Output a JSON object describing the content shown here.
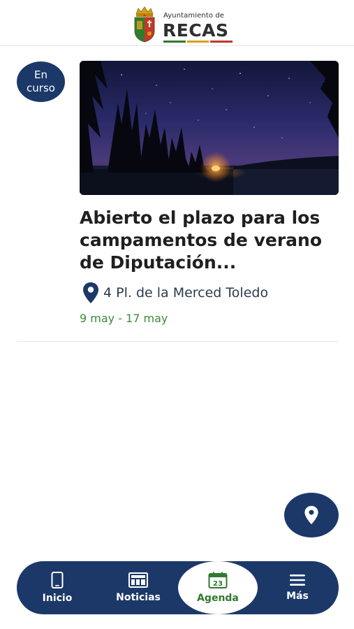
{
  "header": {
    "brand_small": "Ayuntamiento de",
    "brand_name": "RECAS",
    "logo_icon": "coat-of-arms",
    "stripe_colors": [
      "#2f7a2e",
      "#d4a017",
      "#c0392b"
    ]
  },
  "event": {
    "status": "En\ncurso",
    "title": "Abierto el plazo para los campamentos de verano de Diputación...",
    "location": "4 Pl. de la Merced Toledo",
    "dates": "9 may - 17 may",
    "image_subject": "night sky over forest and lake with campfire",
    "location_icon": "map-pin-icon"
  },
  "map_button": {
    "icon": "location-pin-icon"
  },
  "nav": {
    "items": [
      {
        "label": "Inicio",
        "icon": "phone-icon"
      },
      {
        "label": "Noticias",
        "icon": "newspaper-icon"
      },
      {
        "label": "Agenda",
        "icon": "calendar-icon",
        "icon_text": "23",
        "active": true
      },
      {
        "label": "Más",
        "icon": "menu-icon"
      }
    ]
  },
  "colors": {
    "primary": "#1b3869",
    "accent_green": "#3d8a3a",
    "active_nav_text": "#2f7a2e"
  }
}
